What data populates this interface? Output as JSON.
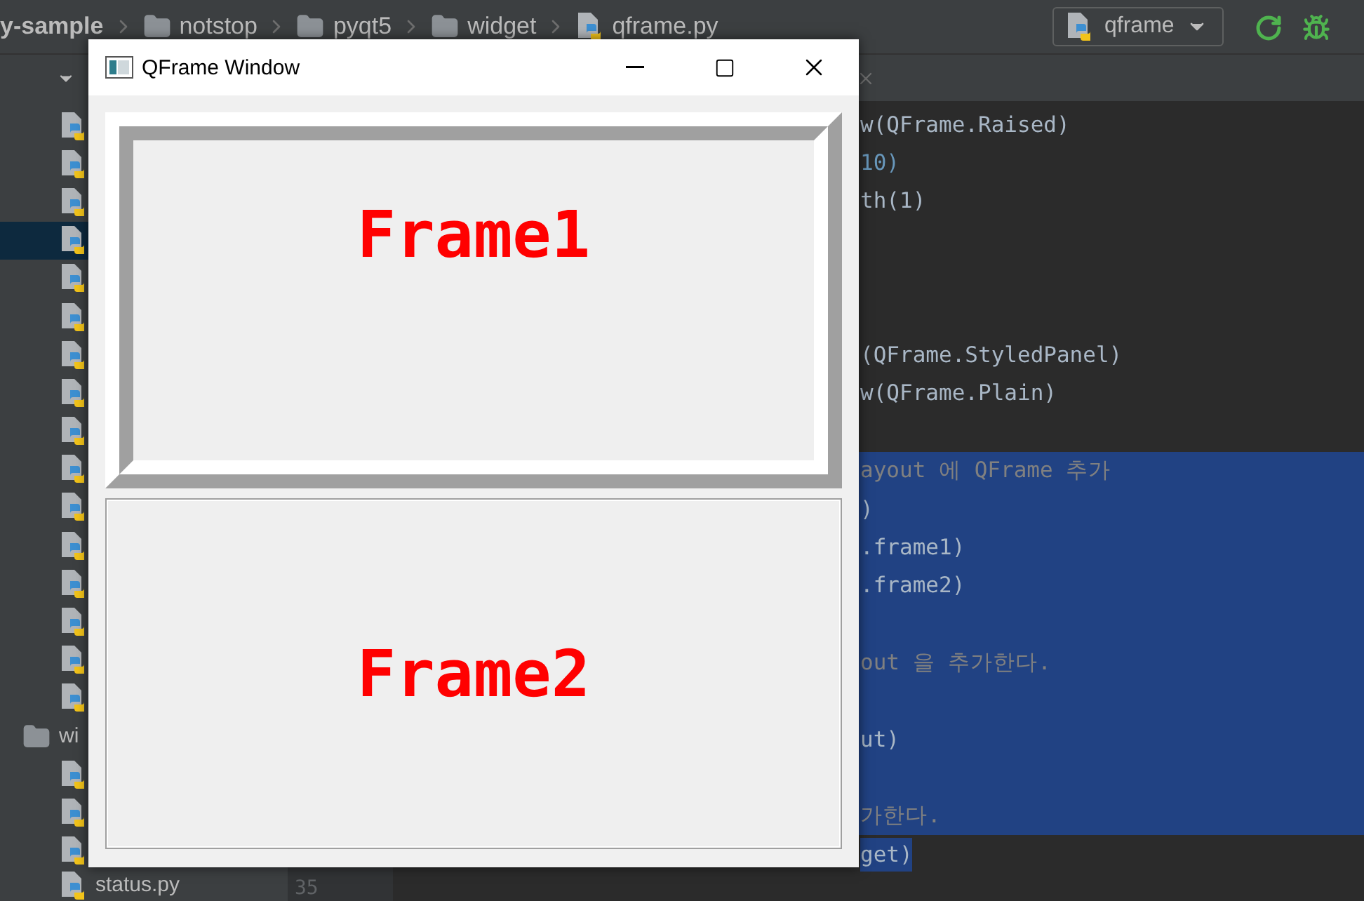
{
  "ide": {
    "breadcrumbs": [
      {
        "kind": "project",
        "label": "y-sample"
      },
      {
        "kind": "folder",
        "label": "notstop"
      },
      {
        "kind": "folder",
        "label": "pyqt5"
      },
      {
        "kind": "folder",
        "label": "widget"
      },
      {
        "kind": "file",
        "label": "qframe.py"
      }
    ],
    "run_config": {
      "label": "qframe"
    },
    "project_items": [
      {
        "kind": "file",
        "selected": false
      },
      {
        "kind": "file",
        "selected": false
      },
      {
        "kind": "file",
        "selected": false
      },
      {
        "kind": "file",
        "selected": true
      },
      {
        "kind": "file",
        "selected": false
      },
      {
        "kind": "file",
        "selected": false
      },
      {
        "kind": "file",
        "selected": false
      },
      {
        "kind": "file",
        "selected": false
      },
      {
        "kind": "file",
        "selected": false
      },
      {
        "kind": "file",
        "selected": false
      },
      {
        "kind": "file",
        "selected": false
      },
      {
        "kind": "file",
        "selected": false
      },
      {
        "kind": "file",
        "selected": false
      },
      {
        "kind": "file",
        "selected": false
      },
      {
        "kind": "file",
        "selected": false
      },
      {
        "kind": "file",
        "selected": false
      },
      {
        "kind": "folder",
        "label": "wi",
        "selected": false
      },
      {
        "kind": "file",
        "selected": false
      },
      {
        "kind": "file",
        "selected": false
      },
      {
        "kind": "file",
        "selected": false
      },
      {
        "kind": "file",
        "label": "status.py",
        "selected": false
      }
    ],
    "gutter_number": "35",
    "code_lines": [
      {
        "text": "w(QFrame.Raised)",
        "kind": "code",
        "selected": false
      },
      {
        "text": "10)",
        "kind": "number",
        "selected": false
      },
      {
        "text": "th(1)",
        "kind": "code",
        "selected": false
      },
      {
        "kind": "blank",
        "selected": false
      },
      {
        "kind": "blank",
        "selected": false
      },
      {
        "kind": "blank",
        "selected": false
      },
      {
        "text": "(QFrame.StyledPanel)",
        "kind": "code",
        "selected": false
      },
      {
        "text": "w(QFrame.Plain)",
        "kind": "code",
        "selected": false
      },
      {
        "kind": "blank",
        "selected": false
      },
      {
        "text": "ayout 에 QFrame 추가",
        "kind": "comment",
        "selected": true
      },
      {
        "text": ")",
        "kind": "code",
        "selected": true
      },
      {
        "text": ".frame1)",
        "kind": "code",
        "selected": true
      },
      {
        "text": ".frame2)",
        "kind": "code",
        "selected": true
      },
      {
        "kind": "blank",
        "selected": true
      },
      {
        "text": "out 을 추가한다.",
        "kind": "comment",
        "selected": true
      },
      {
        "kind": "blank",
        "selected": true
      },
      {
        "text": "ut)",
        "kind": "code",
        "selected": true
      },
      {
        "kind": "blank",
        "selected": true
      },
      {
        "text": "가한다.",
        "kind": "comment",
        "selected": true
      },
      {
        "text": "get)",
        "kind": "code",
        "selected": true
      }
    ]
  },
  "window": {
    "title": "QFrame Window",
    "frames": [
      {
        "label": "Frame1",
        "kind": "raised"
      },
      {
        "label": "Frame2",
        "kind": "plain"
      }
    ]
  }
}
